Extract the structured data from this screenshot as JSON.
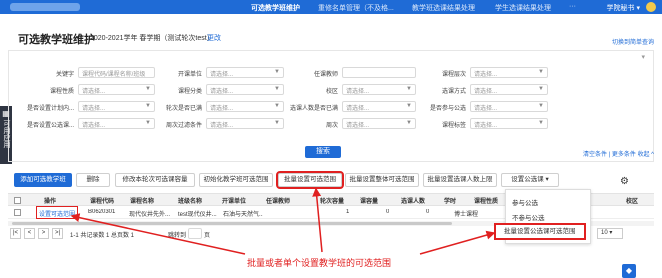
{
  "topbar": {
    "nav": [
      "可选教学班维护",
      "重修名单管理（不及格...",
      "教学班选课结果处理",
      "学生选课结果处理",
      "···"
    ],
    "user": "学院秘书 ▾"
  },
  "appstrip": {
    "label": "可用应用"
  },
  "page": {
    "title": "可选教学班维护",
    "subtitle": "2020-2021学年 春学期（测试轮次test）",
    "edit": "更改",
    "switch_link": "切换到简单查询"
  },
  "filters": {
    "row1": [
      {
        "label": "关键字",
        "value": "课程代码/课程名称/班级"
      },
      {
        "label": "开课单位",
        "value": "请选择..."
      },
      {
        "label": "任课教师",
        "value": ""
      },
      {
        "label": "课程层次",
        "value": "请选择..."
      }
    ],
    "row2": [
      {
        "label": "课程性质",
        "value": "请选择..."
      },
      {
        "label": "课程分类",
        "value": "请选择..."
      },
      {
        "label": "校区",
        "value": "请选择..."
      },
      {
        "label": "选课方式",
        "value": "请选择..."
      }
    ],
    "row3": [
      {
        "label": "是否设置计划内...",
        "value": "请选择..."
      },
      {
        "label": "轮次是否已满",
        "value": "请选择..."
      },
      {
        "label": "选课人数是否已满",
        "value": "请选择..."
      },
      {
        "label": "是否参与公选",
        "value": "请选择..."
      }
    ],
    "row4": [
      {
        "label": "是否设置公选课...",
        "value": "请选择..."
      },
      {
        "label": "周次过滤条件",
        "value": "请选择..."
      },
      {
        "label": "周次",
        "value": "请选择..."
      },
      {
        "label": "课程标签",
        "value": "请选择..."
      }
    ],
    "search": "搜索",
    "clear": "清空条件 | 更多条件  收起 ^"
  },
  "toolbar": {
    "buttons": [
      "添加可选教学班",
      "删除",
      "修改本轮次可选课容量",
      "初始化教学班可选范围",
      "批量设置可选范围",
      "批量设置整体可选范围",
      "批量设置选课人数上限",
      "设置公选课 ▾"
    ]
  },
  "table": {
    "headers": [
      "操作",
      "课程代码",
      "课程名称",
      "班级名称",
      "开课单位",
      "任课教师",
      "轮次容量",
      "课容量",
      "选课人数",
      "学时",
      "课程性质",
      "校区"
    ],
    "row": [
      "设置可选范围",
      "B0620301",
      "现代仪井先外...",
      "test现代仪井...",
      "石油与天然气...",
      "",
      "1",
      "0",
      "0",
      "",
      "博士课程",
      ""
    ]
  },
  "pager": {
    "info": "1-1 共记录数 1  总页数 1",
    "page_label": "跳转到",
    "page": "页",
    "size": "10"
  },
  "dropdown": {
    "items": [
      "参与公选",
      "不参与公选",
      "批量设置公选课可选范围"
    ]
  },
  "caption": "批量或者单个设置教学班的可选范围",
  "colors": {
    "primary": "#1f6bd6",
    "annotation": "#e02020"
  }
}
